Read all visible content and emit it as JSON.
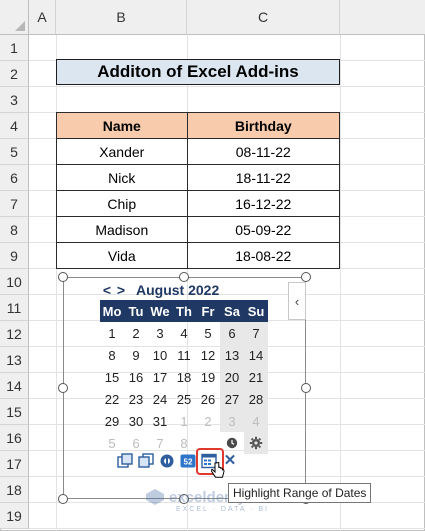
{
  "sheet": {
    "columns": [
      "A",
      "B",
      "C"
    ],
    "rows": [
      "1",
      "2",
      "3",
      "4",
      "5",
      "6",
      "7",
      "8",
      "9",
      "10",
      "11",
      "12",
      "13",
      "14",
      "15",
      "16",
      "17",
      "18",
      "19"
    ]
  },
  "title": "Additon of Excel Add-ins",
  "table": {
    "headers": [
      "Name",
      "Birthday"
    ],
    "rows": [
      [
        "Xander",
        "08-11-22"
      ],
      [
        "Nick",
        "18-11-22"
      ],
      [
        "Chip",
        "16-12-22"
      ],
      [
        "Madison",
        "05-09-22"
      ],
      [
        "Vida",
        "18-08-22"
      ]
    ]
  },
  "calendar": {
    "prev": "<",
    "next": ">",
    "month": "August 2022",
    "weekdays": [
      "Mo",
      "Tu",
      "We",
      "Th",
      "Fr",
      "Sa",
      "Su"
    ],
    "weeks": [
      [
        "1",
        "2",
        "3",
        "4",
        "5",
        "6",
        "7"
      ],
      [
        "8",
        "9",
        "10",
        "11",
        "12",
        "13",
        "14"
      ],
      [
        "15",
        "16",
        "17",
        "18",
        "19",
        "20",
        "21"
      ],
      [
        "22",
        "23",
        "24",
        "25",
        "26",
        "27",
        "28"
      ],
      [
        "29",
        "30",
        "31",
        "1",
        "2",
        "3",
        "4"
      ],
      [
        "5",
        "6",
        "7",
        "8"
      ]
    ],
    "side_tab": "‹",
    "toolbar_icons": [
      "insert-date-icon",
      "insert-date-alt-icon",
      "settings-globe-icon",
      "week-number-icon",
      "highlight-range-icon",
      "close-icon"
    ],
    "week_number_label": "52",
    "close_glyph": "✕",
    "tooltip": "Highlight Range of Dates"
  },
  "watermark": {
    "name": "exceldemy",
    "tagline": "EXCEL · DATA · BI"
  },
  "colors": {
    "header_bg": "#1f3864",
    "table_header_bg": "#f8cbad",
    "title_bg": "#dce6f1",
    "highlight_border": "#e03a2e"
  }
}
